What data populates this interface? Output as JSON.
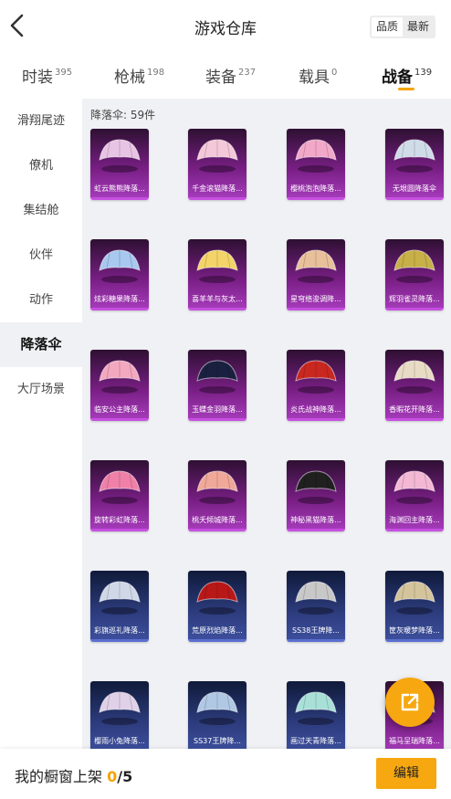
{
  "header": {
    "title": "游戏仓库",
    "sort_quality": "品质",
    "sort_newest": "最新"
  },
  "tabs": [
    {
      "label": "时装",
      "count": "395"
    },
    {
      "label": "枪械",
      "count": "198"
    },
    {
      "label": "装备",
      "count": "237"
    },
    {
      "label": "载具",
      "count": "0"
    },
    {
      "label": "战备",
      "count": "139"
    }
  ],
  "active_tab": "战备",
  "sidebar": {
    "items": [
      {
        "label": "滑翔尾迹"
      },
      {
        "label": "僚机"
      },
      {
        "label": "集结舱"
      },
      {
        "label": "伙伴"
      },
      {
        "label": "动作"
      },
      {
        "label": "降落伞"
      },
      {
        "label": "大厅场景"
      }
    ],
    "active": "降落伞"
  },
  "content": {
    "count_label": "降落伞: 59件",
    "items": [
      {
        "name": "虹云熊熊降落...",
        "rarity": "purple",
        "color": "#e8c4e4"
      },
      {
        "name": "千金滚猫降落...",
        "rarity": "purple",
        "color": "#f4c8d8"
      },
      {
        "name": "樱桃泡泡降落...",
        "rarity": "purple",
        "color": "#f2a8c8"
      },
      {
        "name": "无垠圆降落伞",
        "rarity": "purple",
        "color": "#d0dce8"
      },
      {
        "name": "炫彩糖果降落...",
        "rarity": "purple",
        "color": "#a8c8f0"
      },
      {
        "name": "喜羊羊与灰太...",
        "rarity": "purple",
        "color": "#f4d468"
      },
      {
        "name": "星穹络浚调降...",
        "rarity": "purple",
        "color": "#e8c09a"
      },
      {
        "name": "辉羽雀灵降落...",
        "rarity": "purple",
        "color": "#c8b048"
      },
      {
        "name": "临安公主降落...",
        "rarity": "purple",
        "color": "#f4a8c0"
      },
      {
        "name": "玉蝶金羽降落...",
        "rarity": "purple",
        "color": "#1a2040"
      },
      {
        "name": "炎氏战神降落...",
        "rarity": "purple",
        "color": "#c82820"
      },
      {
        "name": "香暇花开降落...",
        "rarity": "purple",
        "color": "#e8dcc4"
      },
      {
        "name": "旋转彩虹降落...",
        "rarity": "purple",
        "color": "#f080a8"
      },
      {
        "name": "桃夭倾城降落...",
        "rarity": "purple",
        "color": "#f0a898"
      },
      {
        "name": "神秘黑猫降落...",
        "rarity": "purple",
        "color": "#202020"
      },
      {
        "name": "海渊回主降落...",
        "rarity": "purple",
        "color": "#f4b8d4"
      },
      {
        "name": "彩旗巡礼降落...",
        "rarity": "blue",
        "color": "#d0d8e8"
      },
      {
        "name": "荒原烈焰降落...",
        "rarity": "blue",
        "color": "#b81818"
      },
      {
        "name": "SS38王牌降...",
        "rarity": "blue",
        "color": "#c8c8c8"
      },
      {
        "name": "筐灰暖梦降落...",
        "rarity": "blue",
        "color": "#d4c49c"
      },
      {
        "name": "樱雨小兔降落...",
        "rarity": "blue",
        "color": "#e0d0e8"
      },
      {
        "name": "SS37王牌降...",
        "rarity": "blue",
        "color": "#b0c8e4"
      },
      {
        "name": "画过天青降落...",
        "rarity": "blue",
        "color": "#a8e0d8"
      },
      {
        "name": "福马呈瑞降落...",
        "rarity": "purple",
        "color": "#e8c8a0"
      }
    ]
  },
  "bottom": {
    "label": "我的橱窗上架",
    "current": "0",
    "separator": "/",
    "max": "5",
    "edit_label": "编辑"
  },
  "colors": {
    "accent": "#f7a70f",
    "content_bg": "#f0f1f4",
    "rarity_purple": "#a43ab8",
    "rarity_blue": "#3c4e9c"
  },
  "icons": {
    "back": "chevron-left-icon",
    "share": "external-share-icon"
  }
}
